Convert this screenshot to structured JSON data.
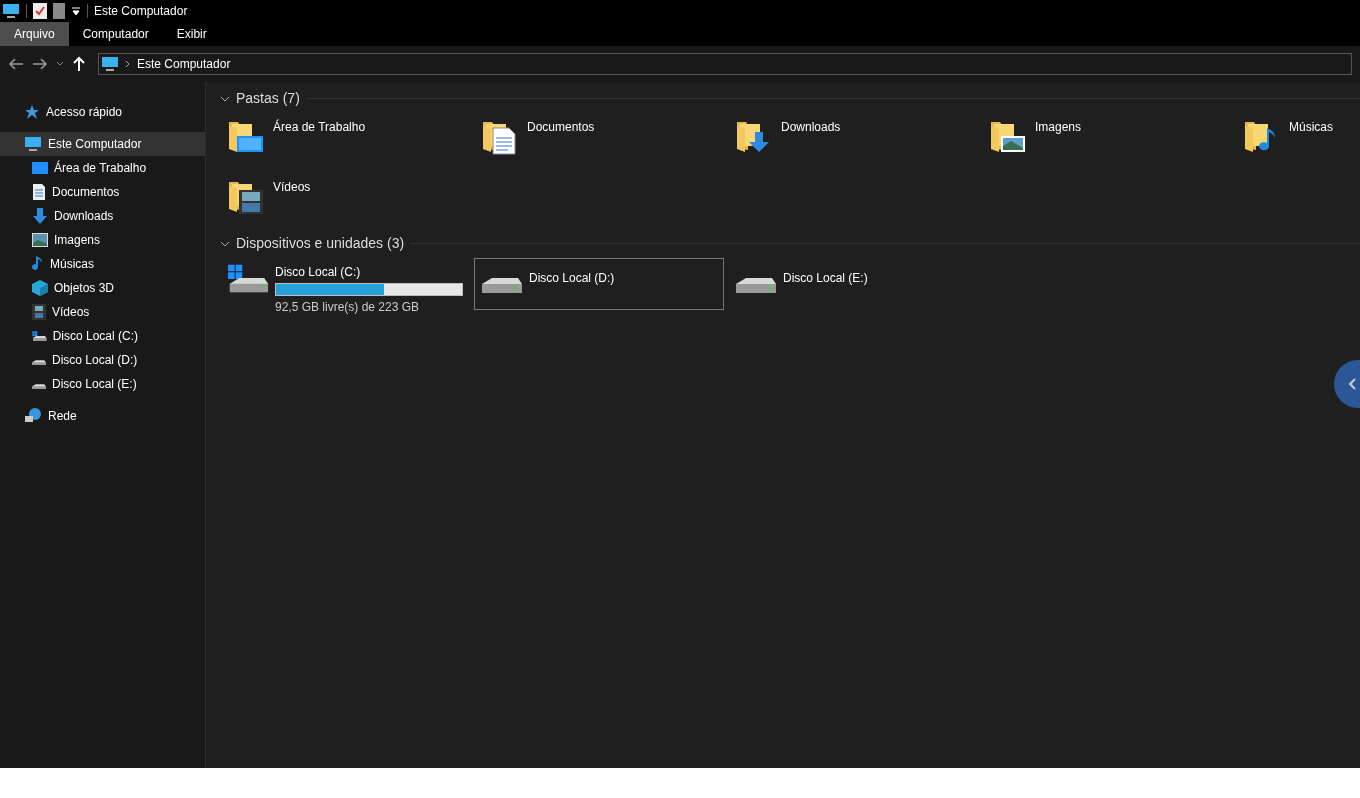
{
  "window": {
    "title": "Este Computador"
  },
  "ribbon_tabs": [
    {
      "label": "Arquivo",
      "selected": true
    },
    {
      "label": "Computador",
      "selected": false
    },
    {
      "label": "Exibir",
      "selected": false
    }
  ],
  "address_bar": {
    "path": "Este Computador"
  },
  "sidebar": {
    "items": [
      {
        "label": "Acesso rápido",
        "kind": "star",
        "selected": false
      },
      {
        "label": "Este Computador",
        "kind": "computer",
        "selected": true,
        "children": [
          {
            "label": "Área de Trabalho",
            "kind": "desktop",
            "selected": false
          },
          {
            "label": "Documentos",
            "kind": "documents",
            "selected": false
          },
          {
            "label": "Downloads",
            "kind": "downloads",
            "selected": false
          },
          {
            "label": "Imagens",
            "kind": "pictures",
            "selected": false
          },
          {
            "label": "Músicas",
            "kind": "music",
            "selected": false
          },
          {
            "label": "Objetos 3D",
            "kind": "cube",
            "selected": false
          },
          {
            "label": "Vídeos",
            "kind": "videos",
            "selected": false
          },
          {
            "label": "Disco Local (C:)",
            "kind": "system_drive",
            "selected": false
          },
          {
            "label": "Disco Local (D:)",
            "kind": "drive",
            "selected": false
          },
          {
            "label": "Disco Local (E:)",
            "kind": "drive",
            "selected": false
          }
        ]
      },
      {
        "label": "Rede",
        "kind": "network",
        "selected": false
      }
    ]
  },
  "folders": {
    "heading": "Pastas (7)",
    "items": [
      {
        "label": "Área de Trabalho",
        "kind": "desktop"
      },
      {
        "label": "Documentos",
        "kind": "documents"
      },
      {
        "label": "Downloads",
        "kind": "downloads"
      },
      {
        "label": "Imagens",
        "kind": "pictures"
      },
      {
        "label": "Músicas",
        "kind": "music"
      },
      {
        "label": "Vídeos",
        "kind": "videos"
      }
    ]
  },
  "devices": {
    "heading": "Dispositivos e unidades (3)",
    "items": [
      {
        "label": "Disco Local (C:)",
        "kind": "system_drive",
        "selected": false,
        "level": 0.58,
        "space": "92,5 GB livre(s) de 223 GB"
      },
      {
        "label": "Disco Local (D:)",
        "kind": "drive",
        "selected": true
      },
      {
        "label": "Disco Local (E:)",
        "kind": "drive",
        "selected": false
      }
    ]
  }
}
